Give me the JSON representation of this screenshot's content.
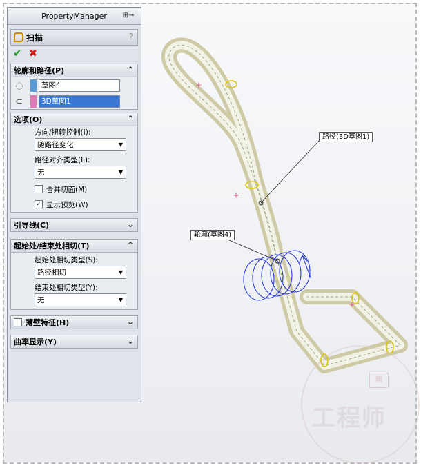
{
  "panel": {
    "title": "PropertyManager",
    "pin_glyph": "⊞⊸"
  },
  "feature": {
    "name": "扫描",
    "help": "?",
    "ok_glyph": "✔",
    "cancel_glyph": "✖"
  },
  "profile_path": {
    "header": "轮廓和路径(P)",
    "profile_value": "草图4",
    "path_value": "3D草图1",
    "profile_color": "#5b9bd5",
    "path_color": "#e07bb5"
  },
  "options": {
    "header": "选项(O)",
    "orientation_label": "方向/扭转控制(I):",
    "orientation_value": "随路径变化",
    "align_label": "路径对齐类型(L):",
    "align_value": "无",
    "merge_faces_label": "合并切面(M)",
    "merge_faces_checked": false,
    "show_preview_label": "显示预览(W)",
    "show_preview_checked": true
  },
  "guide_curves": {
    "header": "引导线(C)"
  },
  "tangency": {
    "header": "起始处/结束处相切(T)",
    "start_label": "起始处相切类型(S):",
    "start_value": "路径相切",
    "end_label": "结束处相切类型(Y):",
    "end_value": "无"
  },
  "thin_feature": {
    "header": "薄壁特征(H)",
    "checked": false
  },
  "curvature_display": {
    "header": "曲率显示(Y)"
  },
  "viewport": {
    "path_callout": "路径(3D草图1)",
    "profile_callout": "轮廓(草图4)"
  },
  "watermark": {
    "text": "工程师",
    "seal": "國"
  }
}
